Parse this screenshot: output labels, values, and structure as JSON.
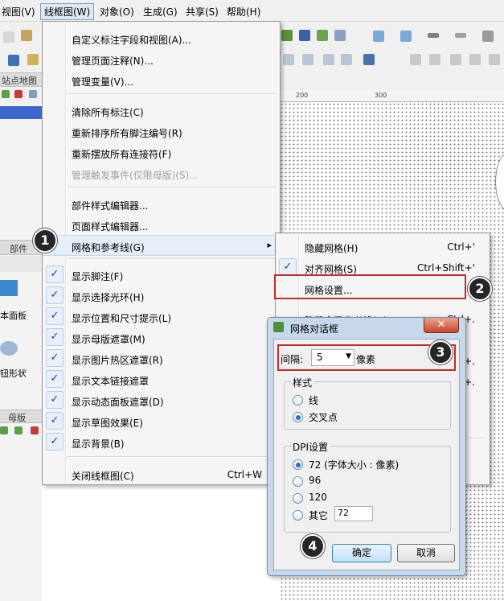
{
  "menubar": [
    "视图(V)",
    "线框图(W)",
    "对象(O)",
    "生成(G)",
    "共享(S)",
    "帮助(H)"
  ],
  "left_panel": {
    "sitemap_title": "站点地图",
    "widgets_title": "部件",
    "widget1": "本面板",
    "widget2": "钮形状",
    "masters_title": "母版"
  },
  "ruler": [
    "200",
    "300"
  ],
  "menu": {
    "items": [
      {
        "label": "自定义标注字段和视图(A)..."
      },
      {
        "label": "管理页面注释(N)..."
      },
      {
        "label": "管理变量(V)..."
      },
      {
        "label": "清除所有标注(C)"
      },
      {
        "label": "重新排序所有脚注编号(R)"
      },
      {
        "label": "重新摆放所有连接符(F)"
      },
      {
        "label": "管理触发事件(仅限母版)(S)..."
      },
      {
        "label": "部件样式编辑器..."
      },
      {
        "label": "页面样式编辑器..."
      },
      {
        "label": "网格和参考线(G)"
      },
      {
        "label": "显示脚注(F)"
      },
      {
        "label": "显示选择光环(H)"
      },
      {
        "label": "显示位置和尺寸提示(L)"
      },
      {
        "label": "显示母版遮罩(M)"
      },
      {
        "label": "显示图片热区遮罩(R)"
      },
      {
        "label": "显示文本链接遮罩"
      },
      {
        "label": "显示动态面板遮罩(D)"
      },
      {
        "label": "显示草图效果(E)"
      },
      {
        "label": "显示背景(B)"
      },
      {
        "label": "关闭线框图(C)",
        "shortcut": "Ctrl+W"
      }
    ],
    "check_mark": "✓",
    "arrow": "▸"
  },
  "submenu": {
    "items": [
      {
        "label": "隐藏网格(H)",
        "shortcut": "Ctrl+'"
      },
      {
        "label": "对齐网格(S)",
        "shortcut": "Ctrl+Shift+'"
      },
      {
        "label": "网格设置..."
      },
      {
        "label": "隐藏全局参考线(G)",
        "shortcut": "Ctrl+."
      }
    ],
    "extra_shortcuts": [
      "+.",
      "+."
    ]
  },
  "dialog": {
    "title": "网格对话框",
    "close": "✕",
    "interval_label": "间隔:",
    "interval_value": "5",
    "interval_unit": "像素",
    "style_group": "样式",
    "style_line": "线",
    "style_cross": "交叉点",
    "dpi_group": "DPI设置",
    "dpi_72": "72 (字体大小 : 像素)",
    "dpi_96": "96",
    "dpi_120": "120",
    "dpi_other": "其它",
    "dpi_other_value": "72",
    "ok": "确定",
    "cancel": "取消"
  },
  "callouts": [
    "1",
    "2",
    "3",
    "4"
  ],
  "colors": {
    "highlight_box": "#c22a2a",
    "callout": "#262626"
  }
}
